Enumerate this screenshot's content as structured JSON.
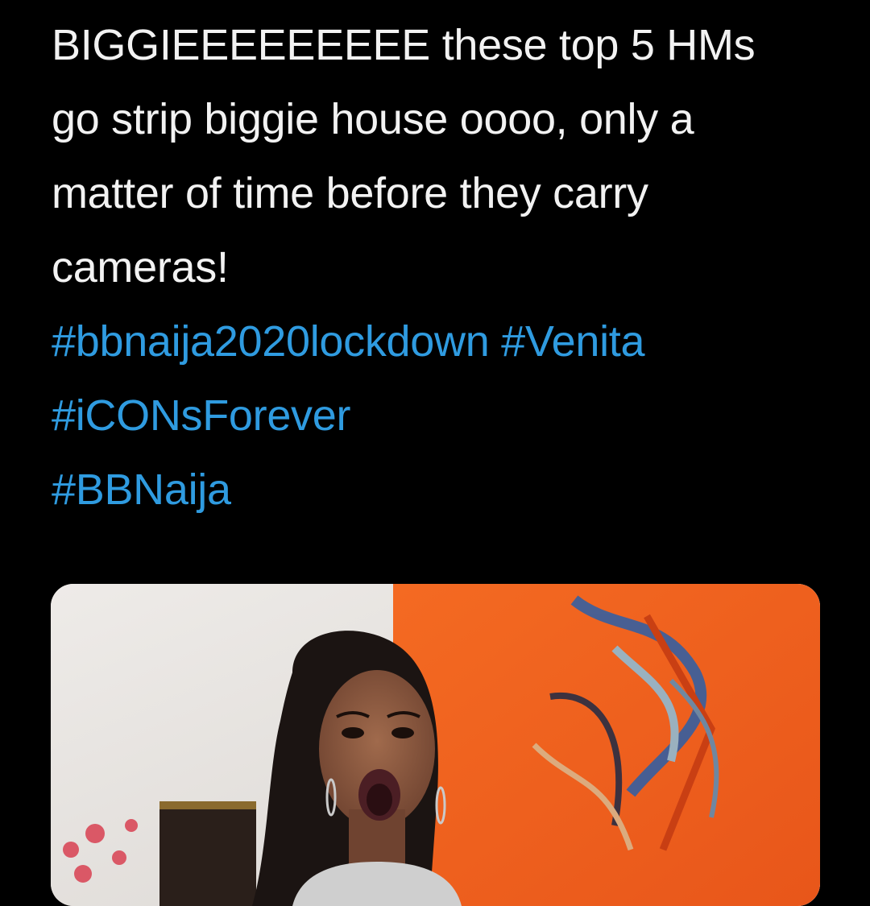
{
  "tweet": {
    "text_lines": [
      "BIGGIEEEEEEEEE these top 5 HMs",
      "go strip biggie house oooo, only a",
      "matter of time before they carry",
      "cameras!"
    ],
    "hashtags": {
      "bbnaija2020lockdown": "#bbnaija2020lockdown",
      "venita": "#Venita",
      "iconsforever": "#iCONsForever",
      "bbnaija": "#BBNaija"
    },
    "link_color": "#2f9be0",
    "text_color": "#f2f2f2"
  },
  "media": {
    "accent_orange": "#f2621c",
    "wall_color": "#e7e4e1"
  }
}
